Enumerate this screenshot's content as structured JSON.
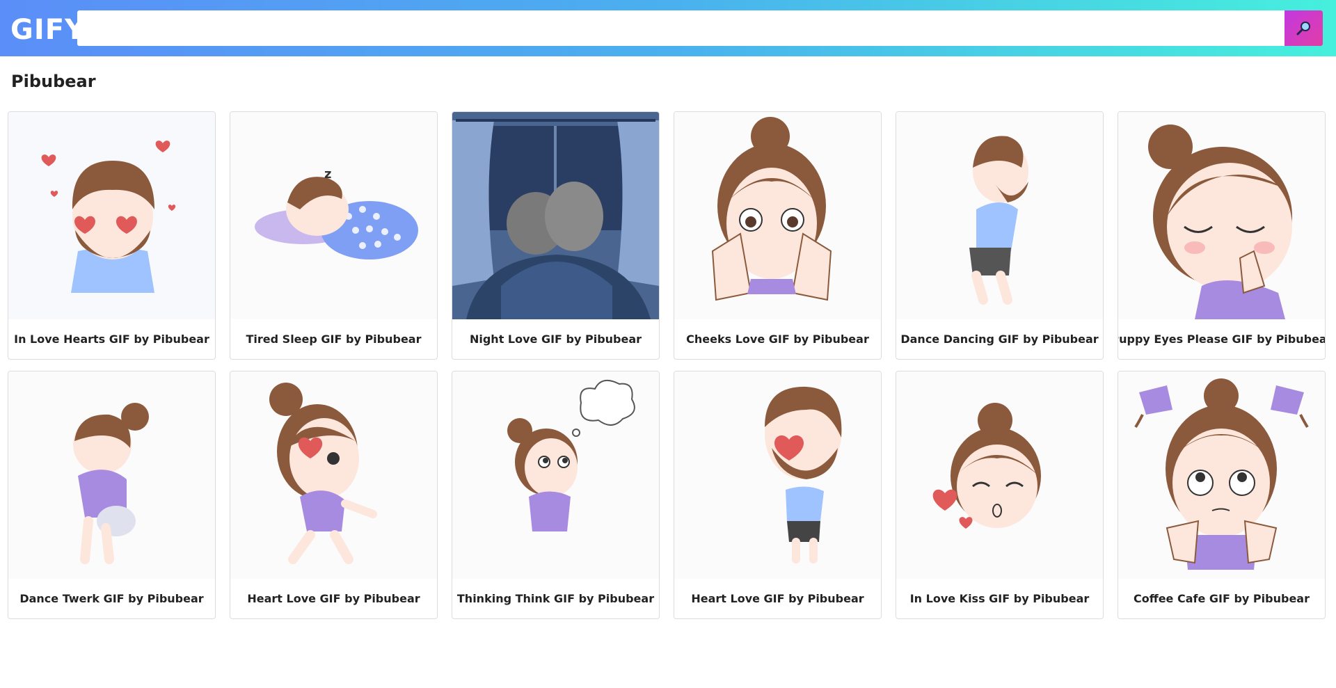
{
  "header": {
    "logo": "GIFY",
    "search_value": "",
    "search_placeholder": "",
    "search_button_icon": "magnifier-icon"
  },
  "page_title": "Pibubear",
  "gifs": [
    {
      "title": "In Love Hearts GIF by Pibubear",
      "art": "bear-hearts"
    },
    {
      "title": "Tired Sleep GIF by Pibubear",
      "art": "bear-sleep"
    },
    {
      "title": "Night Love GIF by Pibubear",
      "art": "couple-window"
    },
    {
      "title": "Cheeks Love GIF by Pibubear",
      "art": "girl-cheeks"
    },
    {
      "title": "Dance Dancing GIF by Pibubear",
      "art": "bear-dance"
    },
    {
      "title": "Puppy Eyes Please GIF by Pibubear",
      "art": "girl-please"
    },
    {
      "title": "Dance Twerk GIF by Pibubear",
      "art": "girl-twerk"
    },
    {
      "title": "Heart Love GIF by Pibubear",
      "art": "girl-heart"
    },
    {
      "title": "Thinking Think GIF by Pibubear",
      "art": "girl-think"
    },
    {
      "title": "Heart Love GIF by Pibubear",
      "art": "bear-heart"
    },
    {
      "title": "In Love Kiss GIF by Pibubear",
      "art": "girl-kiss"
    },
    {
      "title": "Coffee Cafe GIF by Pibubear",
      "art": "girl-coffee"
    }
  ],
  "colors": {
    "header_start": "#5b8ef8",
    "header_end": "#45f0dc",
    "search_button": "#d03bc6",
    "hair": "#8b5a3c",
    "skin": "#fde6dc",
    "blue_shirt": "#9ec3ff",
    "purple_shirt": "#a78be0",
    "heart": "#e05a5a",
    "night": "#4a6690"
  }
}
